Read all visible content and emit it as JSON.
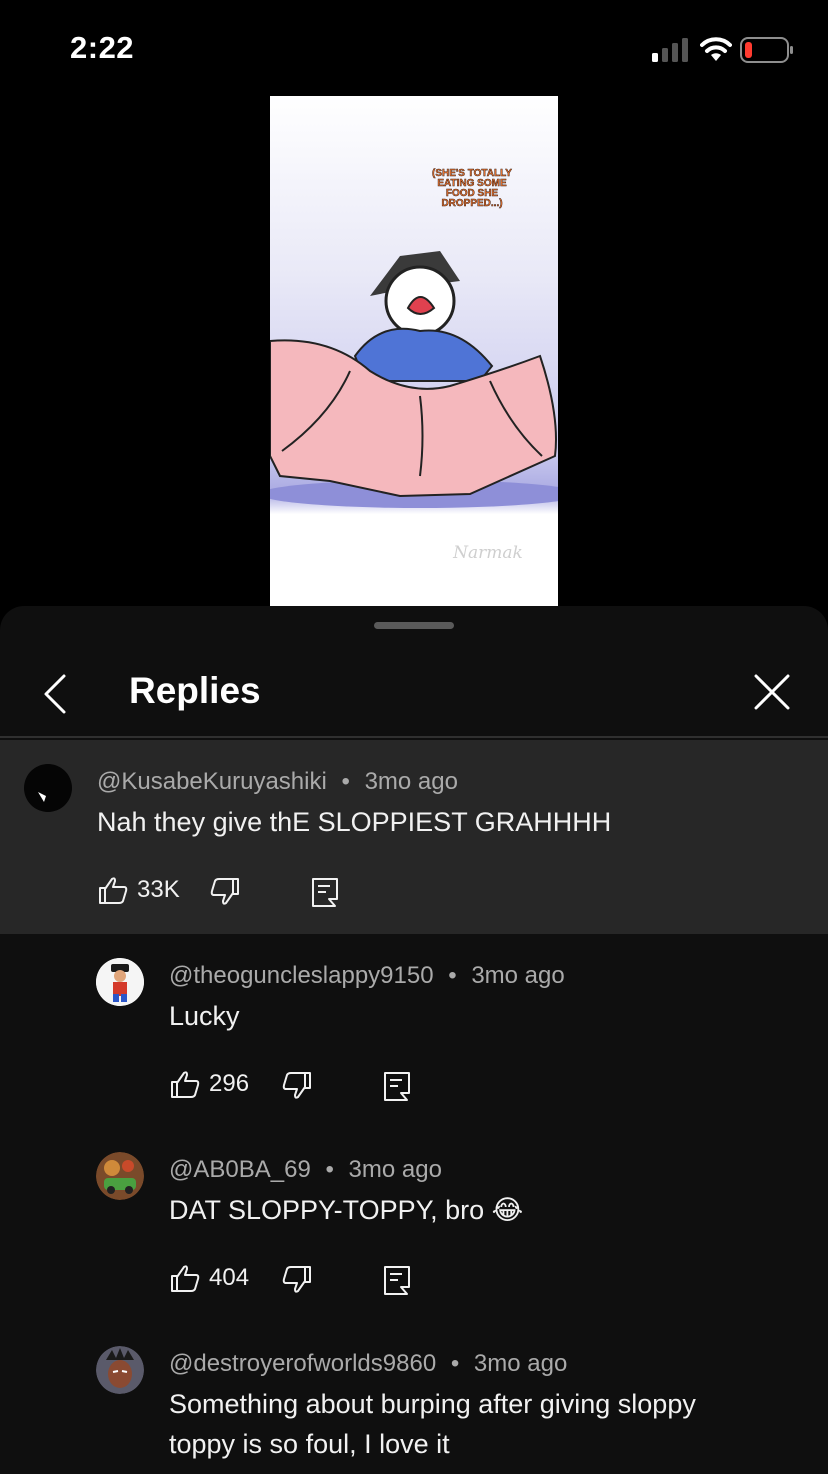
{
  "status": {
    "time": "2:22"
  },
  "video": {
    "caption": [
      "(SHE'S TOTALLY",
      "EATING SOME",
      "FOOD SHE",
      "DROPPED...)"
    ],
    "watermark": "Narmak"
  },
  "sheet": {
    "title": "Replies"
  },
  "parent_comment": {
    "author": "@KusabeKuruyashiki",
    "age": "3mo ago",
    "text": "Nah they give thE SLOPPIEST GRAHHHH",
    "likes": "33K"
  },
  "replies": [
    {
      "author": "@theoguncleslappy9150",
      "age": "3mo ago",
      "text": "Lucky",
      "likes": "296"
    },
    {
      "author": "@AB0BA_69",
      "age": "3mo ago",
      "text": "DAT SLOPPY-TOPPY, bro 😂",
      "likes": "404"
    },
    {
      "author": "@destroyerofworlds9860",
      "age": "3mo ago",
      "text_lines": [
        "Something about burping after giving sloppy",
        "toppy is so foul, I love it"
      ]
    }
  ],
  "separator": "•",
  "icons": {
    "signal": "signal-icon",
    "wifi": "wifi-icon",
    "battery": "battery-low-icon",
    "back": "chevron-left-icon",
    "close": "close-icon",
    "like": "thumbs-up-icon",
    "dislike": "thumbs-down-icon",
    "reply": "reply-icon"
  },
  "colors": {
    "background": "#0f0f0f",
    "highlight": "#272727",
    "battery_low": "#ff3b30",
    "secondary_text": "#aaaaaa"
  }
}
